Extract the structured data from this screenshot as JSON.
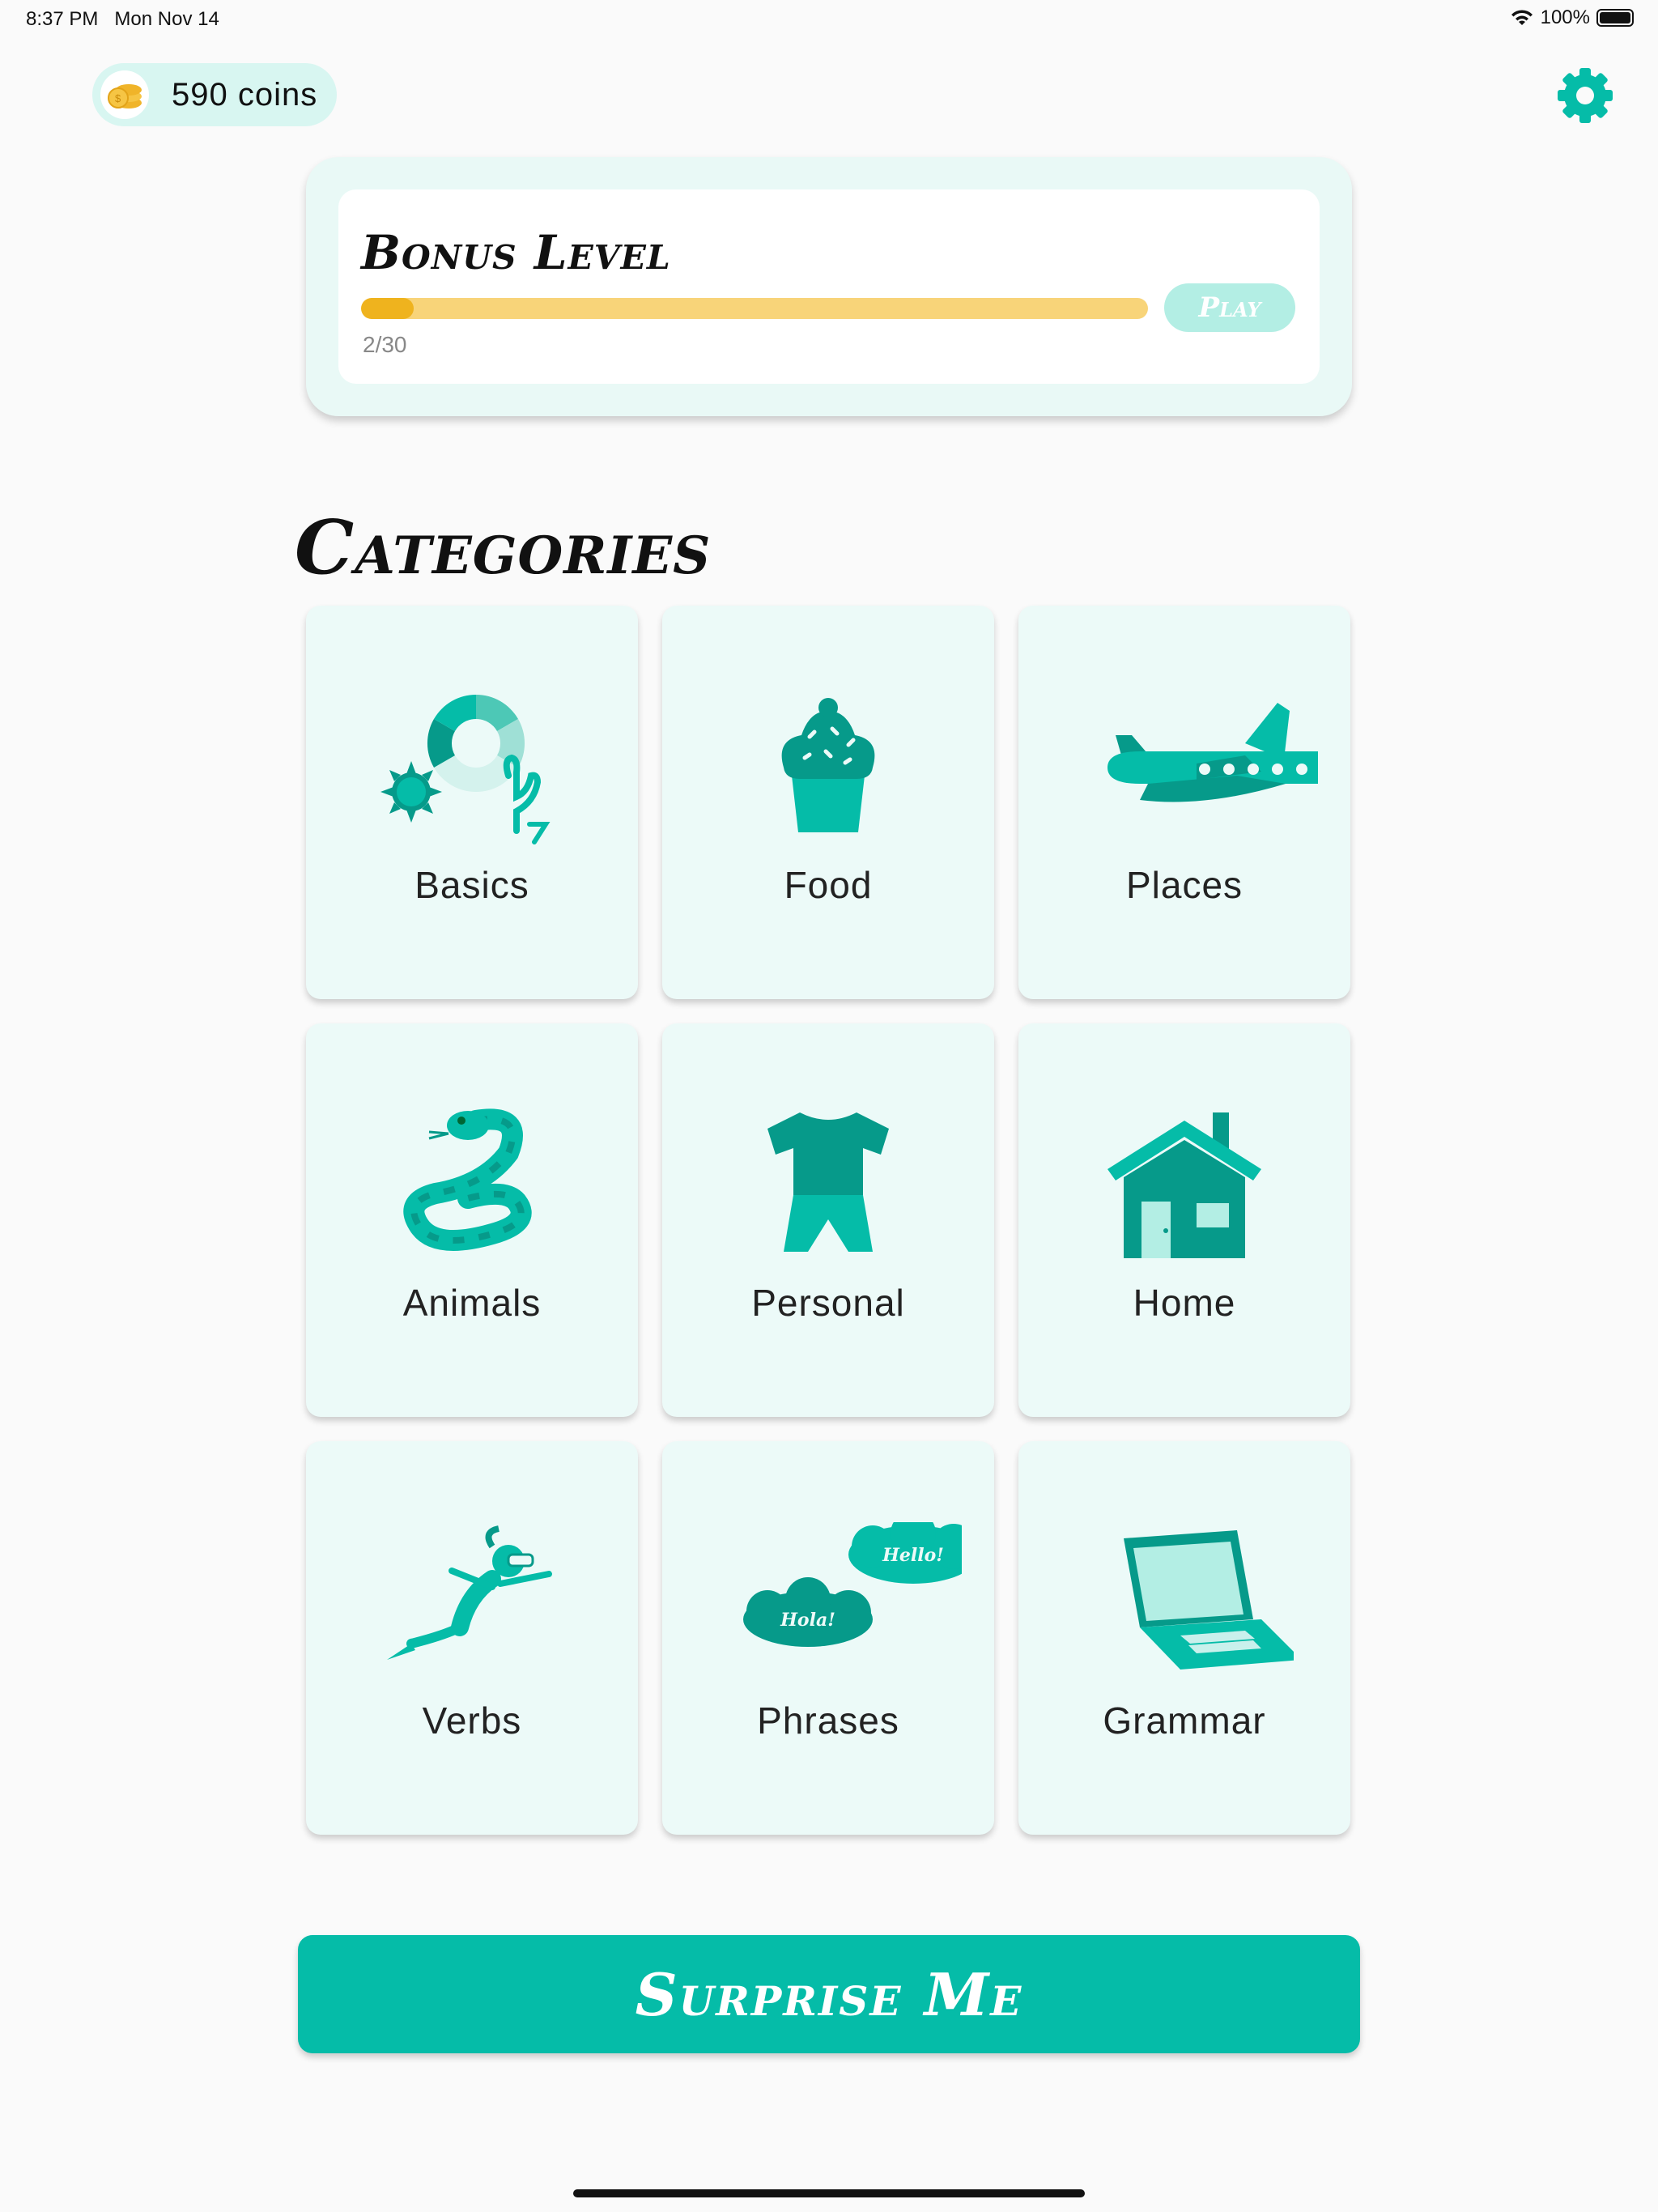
{
  "status_bar": {
    "time": "8:37 PM",
    "date": "Mon Nov 14",
    "battery": "100%"
  },
  "coins": {
    "label": "590 coins",
    "icon": "coin-stack-icon"
  },
  "settings": {
    "icon": "gear-icon"
  },
  "bonus": {
    "title": "Bonus Level",
    "progress_text": "2/30",
    "progress_fraction": 0.0667,
    "play_label": "Play"
  },
  "categories": {
    "title": "Categories",
    "items": [
      {
        "label": "Basics",
        "icon": "basics-icon"
      },
      {
        "label": "Food",
        "icon": "cupcake-icon"
      },
      {
        "label": "Places",
        "icon": "airplane-icon"
      },
      {
        "label": "Animals",
        "icon": "snake-icon"
      },
      {
        "label": "Personal",
        "icon": "clothes-icon"
      },
      {
        "label": "Home",
        "icon": "house-icon"
      },
      {
        "label": "Verbs",
        "icon": "diver-icon"
      },
      {
        "label": "Phrases",
        "icon": "speech-bubbles-icon"
      },
      {
        "label": "Grammar",
        "icon": "laptop-icon"
      }
    ],
    "phrases_bubbles": [
      "Hello!",
      "Hola!"
    ]
  },
  "surprise": {
    "label": "Surprise Me"
  },
  "colors": {
    "accent": "#05bca8",
    "accent_dark": "#069a8a",
    "tile_bg": "#ecfaf8",
    "progress_track": "#f8d479",
    "progress_fill": "#efb31e"
  }
}
